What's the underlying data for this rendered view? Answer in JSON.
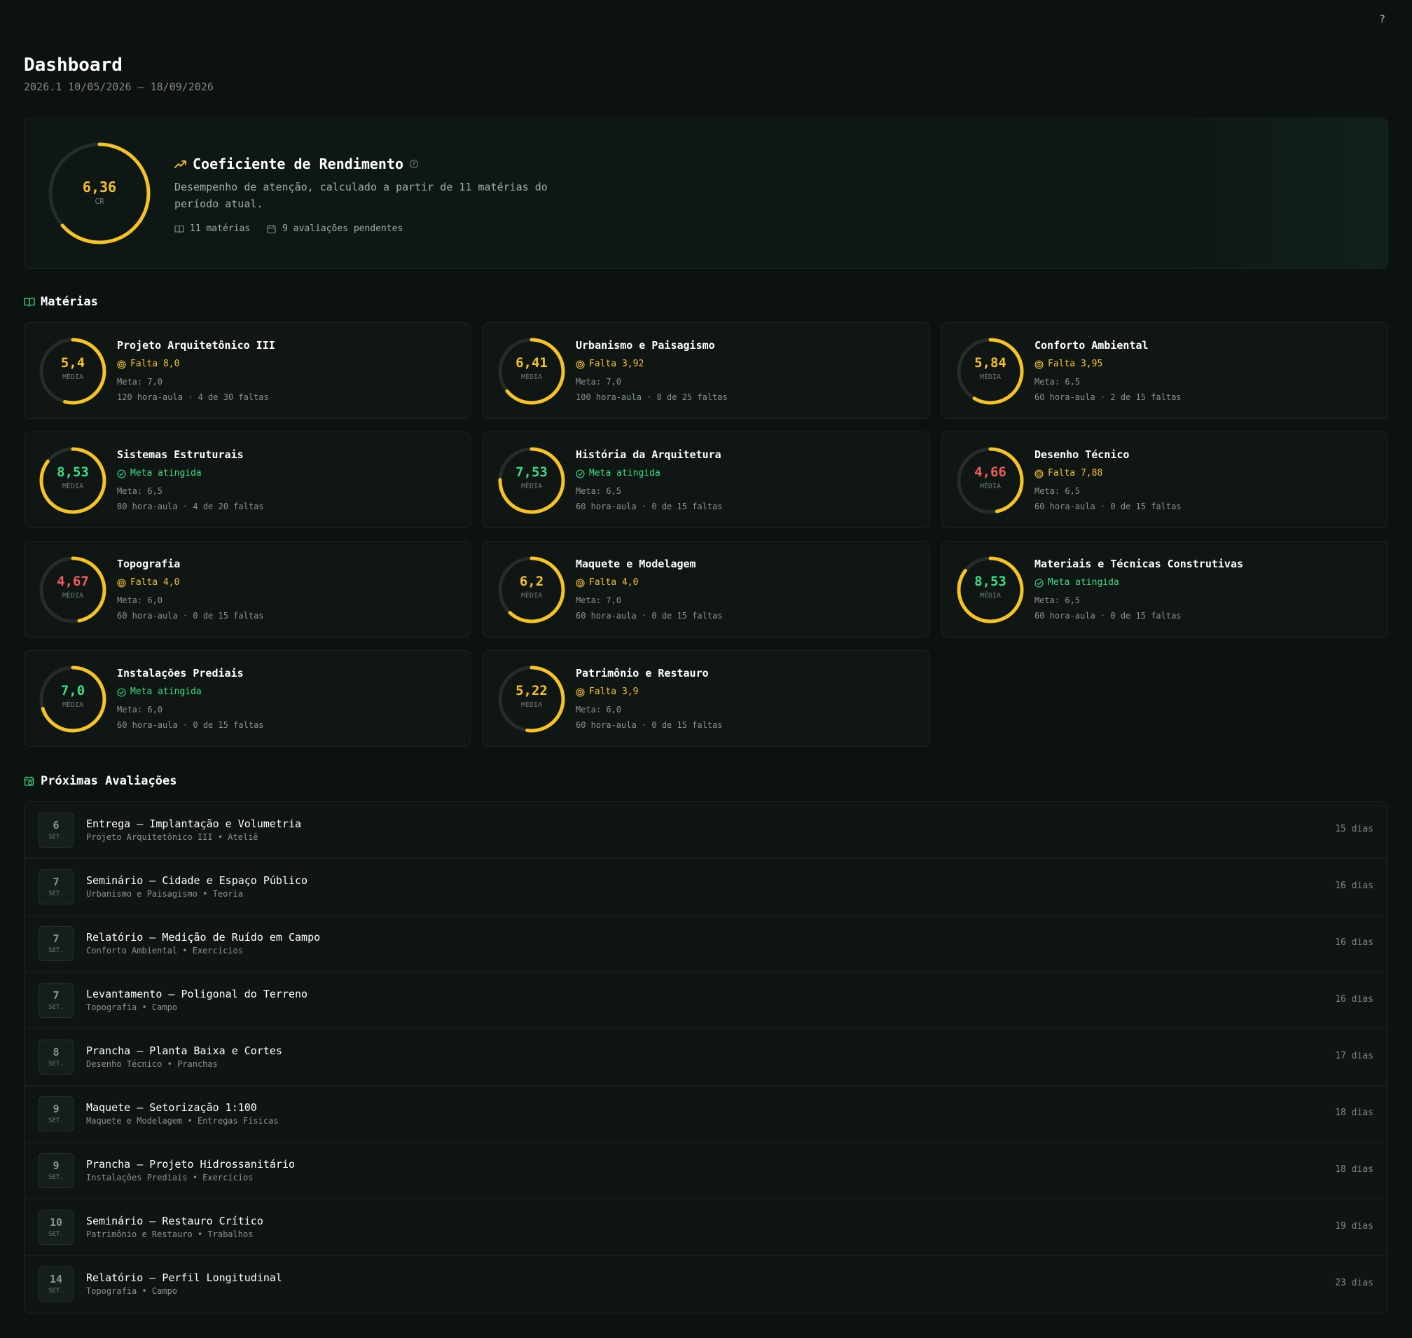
{
  "help_label": "?",
  "header": {
    "title": "Dashboard",
    "subtitle": "2026.1 10/05/2026 – 18/09/2026"
  },
  "cr": {
    "value": "6,36",
    "value_num": 6.36,
    "label": "CR",
    "title": "Coeficiente de Rendimento",
    "description": "Desempenho de atenção, calculado a partir de 11 matérias do período atual.",
    "subjects_count": "11 matérias",
    "pending": "9 avaliações pendentes",
    "color": "#f5c228"
  },
  "subjects_section": {
    "title": "Matérias"
  },
  "colors": {
    "yellow": "#f5c228",
    "green": "#3ddc84",
    "red": "#ef5d5d",
    "track": "#252d29"
  },
  "subjects": [
    {
      "name": "Projeto Arquitetônico III",
      "value": "5,4",
      "num": 5.4,
      "label": "MÉDIA",
      "value_color": "yellow",
      "status": "Falta 8,0",
      "status_type": "pending",
      "meta": "Meta: 7,0",
      "hours": "120 hora-aula · 4 de 30 faltas"
    },
    {
      "name": "Urbanismo e Paisagismo",
      "value": "6,41",
      "num": 6.41,
      "label": "MÉDIA",
      "value_color": "yellow",
      "status": "Falta 3,92",
      "status_type": "pending",
      "meta": "Meta: 7,0",
      "hours": "100 hora-aula · 8 de 25 faltas"
    },
    {
      "name": "Conforto Ambiental",
      "value": "5,84",
      "num": 5.84,
      "label": "MÉDIA",
      "value_color": "yellow",
      "status": "Falta 3,95",
      "status_type": "pending",
      "meta": "Meta: 6,5",
      "hours": "60 hora-aula · 2 de 15 faltas"
    },
    {
      "name": "Sistemas Estruturais",
      "value": "8,53",
      "num": 8.53,
      "label": "MÉDIA",
      "value_color": "green",
      "status": "Meta atingida",
      "status_type": "ok",
      "meta": "Meta: 6,5",
      "hours": "80 hora-aula · 4 de 20 faltas"
    },
    {
      "name": "História da Arquitetura",
      "value": "7,53",
      "num": 7.53,
      "label": "MÉDIA",
      "value_color": "green",
      "status": "Meta atingida",
      "status_type": "ok",
      "meta": "Meta: 6,5",
      "hours": "60 hora-aula · 0 de 15 faltas"
    },
    {
      "name": "Desenho Técnico",
      "value": "4,66",
      "num": 4.66,
      "label": "MÉDIA",
      "value_color": "red",
      "status": "Falta 7,88",
      "status_type": "pending",
      "meta": "Meta: 6,5",
      "hours": "60 hora-aula · 0 de 15 faltas"
    },
    {
      "name": "Topografia",
      "value": "4,67",
      "num": 4.67,
      "label": "MÉDIA",
      "value_color": "red",
      "status": "Falta 4,0",
      "status_type": "pending",
      "meta": "Meta: 6,0",
      "hours": "60 hora-aula · 0 de 15 faltas"
    },
    {
      "name": "Maquete e Modelagem",
      "value": "6,2",
      "num": 6.2,
      "label": "MÉDIA",
      "value_color": "yellow",
      "status": "Falta 4,0",
      "status_type": "pending",
      "meta": "Meta: 7,0",
      "hours": "60 hora-aula · 0 de 15 faltas"
    },
    {
      "name": "Materiais e Técnicas Construtivas",
      "value": "8,53",
      "num": 8.53,
      "label": "MÉDIA",
      "value_color": "green",
      "status": "Meta atingida",
      "status_type": "ok",
      "meta": "Meta: 6,5",
      "hours": "60 hora-aula · 0 de 15 faltas"
    },
    {
      "name": "Instalações Prediais",
      "value": "7,0",
      "num": 7.0,
      "label": "MÉDIA",
      "value_color": "green",
      "status": "Meta atingida",
      "status_type": "ok",
      "meta": "Meta: 6,0",
      "hours": "60 hora-aula · 0 de 15 faltas"
    },
    {
      "name": "Patrimônio e Restauro",
      "value": "5,22",
      "num": 5.22,
      "label": "MÉDIA",
      "value_color": "yellow",
      "status": "Falta 3,9",
      "status_type": "pending",
      "meta": "Meta: 6,0",
      "hours": "60 hora-aula · 0 de 15 faltas"
    }
  ],
  "evaluations_section": {
    "title": "Próximas Avaliações"
  },
  "evaluations": [
    {
      "day": "6",
      "month": "SET.",
      "title": "Entrega — Implantação e Volumetria",
      "subtitle": "Projeto Arquitetônico III • Ateliê",
      "days": "15 dias"
    },
    {
      "day": "7",
      "month": "SET.",
      "title": "Seminário — Cidade e Espaço Público",
      "subtitle": "Urbanismo e Paisagismo • Teoria",
      "days": "16 dias"
    },
    {
      "day": "7",
      "month": "SET.",
      "title": "Relatório — Medição de Ruído em Campo",
      "subtitle": "Conforto Ambiental • Exercícios",
      "days": "16 dias"
    },
    {
      "day": "7",
      "month": "SET.",
      "title": "Levantamento — Poligonal do Terreno",
      "subtitle": "Topografia • Campo",
      "days": "16 dias"
    },
    {
      "day": "8",
      "month": "SET.",
      "title": "Prancha — Planta Baixa e Cortes",
      "subtitle": "Desenho Técnico • Pranchas",
      "days": "17 dias"
    },
    {
      "day": "9",
      "month": "SET.",
      "title": "Maquete — Setorização 1:100",
      "subtitle": "Maquete e Modelagem • Entregas Físicas",
      "days": "18 dias"
    },
    {
      "day": "9",
      "month": "SET.",
      "title": "Prancha — Projeto Hidrossanitário",
      "subtitle": "Instalações Prediais • Exercícios",
      "days": "18 dias"
    },
    {
      "day": "10",
      "month": "SET.",
      "title": "Seminário — Restauro Crítico",
      "subtitle": "Patrimônio e Restauro • Trabalhos",
      "days": "19 dias"
    },
    {
      "day": "14",
      "month": "SET.",
      "title": "Relatório — Perfil Longitudinal",
      "subtitle": "Topografia • Campo",
      "days": "23 dias"
    }
  ]
}
